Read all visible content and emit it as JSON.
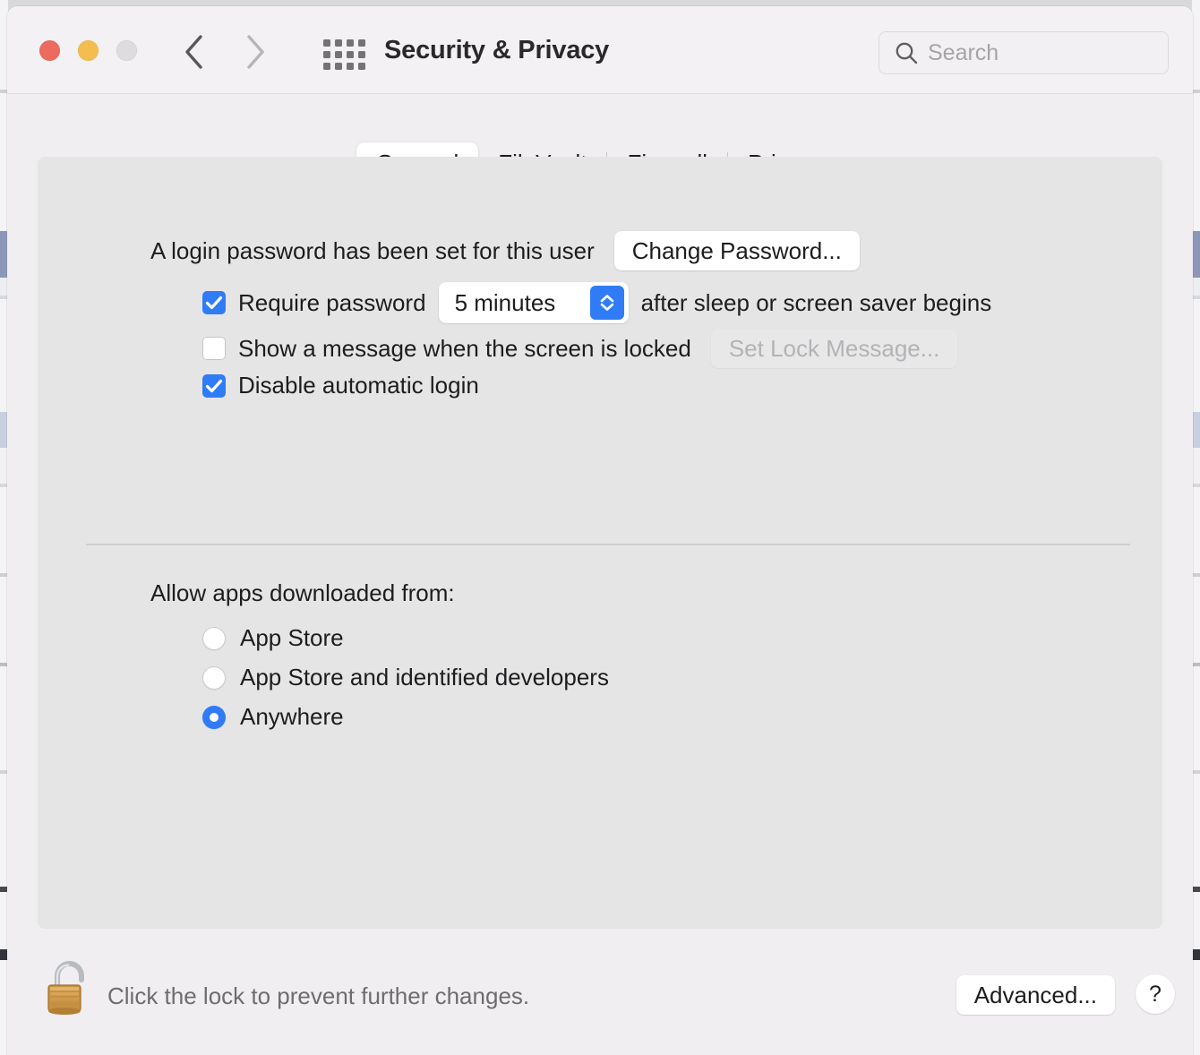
{
  "window": {
    "title": "Security & Privacy",
    "traffic_lights": [
      "close-button",
      "minimize-button",
      "zoom-button"
    ],
    "nav": {
      "back": "chevron-left-icon",
      "forward": "chevron-right-icon"
    },
    "grid_icon": "apps-grid-icon"
  },
  "search": {
    "placeholder": "Search",
    "icon": "search-icon"
  },
  "tabs": [
    {
      "label": "General",
      "active": true
    },
    {
      "label": "FileVault",
      "active": false
    },
    {
      "label": "Firewall",
      "active": false
    },
    {
      "label": "Privacy",
      "active": false
    }
  ],
  "general": {
    "password_status": "A login password has been set for this user",
    "change_password_label": "Change Password...",
    "require_password": {
      "checked": true,
      "label": "Require password",
      "value": "5 minutes",
      "suffix": "after sleep or screen saver begins"
    },
    "show_message": {
      "checked": false,
      "label": "Show a message when the screen is locked",
      "button_label": "Set Lock Message...",
      "button_disabled": true
    },
    "disable_auto_login": {
      "checked": true,
      "label": "Disable automatic login"
    }
  },
  "gatekeeper": {
    "heading": "Allow apps downloaded from:",
    "options": [
      {
        "label": "App Store",
        "selected": false
      },
      {
        "label": "App Store and identified developers",
        "selected": false
      },
      {
        "label": "Anywhere",
        "selected": true
      }
    ]
  },
  "footer": {
    "lock_icon": "unlocked-padlock-icon",
    "lock_text": "Click the lock to prevent further changes.",
    "advanced_label": "Advanced...",
    "help_label": "?"
  },
  "colors": {
    "accent": "#2f7cf6",
    "window_bg": "#f0eef0",
    "panel_bg": "#e6e5e6",
    "titlebar_bg": "#f3f1f3",
    "close": "#ec6a5e",
    "minimize": "#f4bd4f",
    "zoom": "#dddddd"
  }
}
